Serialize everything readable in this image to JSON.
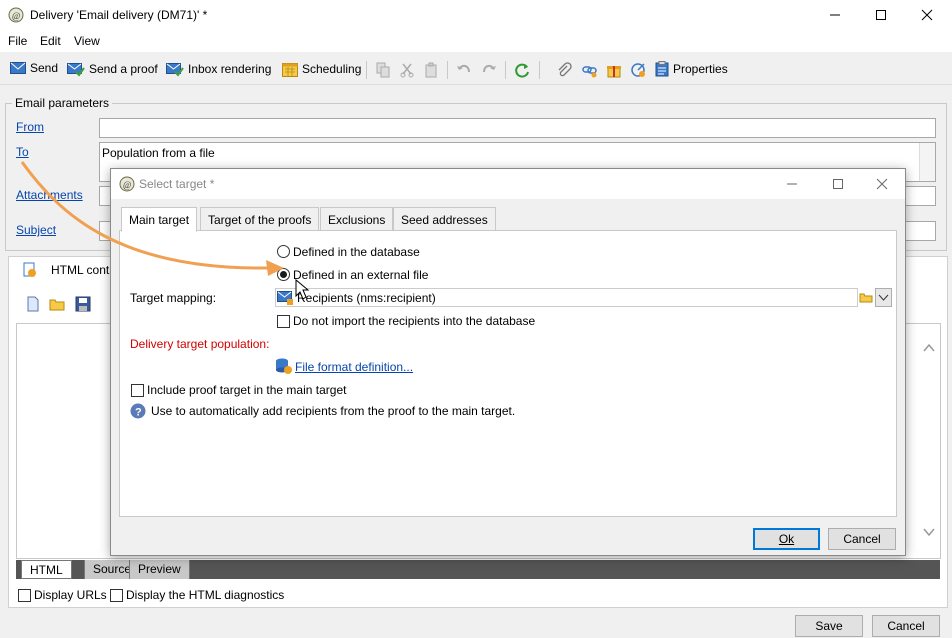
{
  "window": {
    "title": "Delivery 'Email delivery (DM71)' *"
  },
  "menu": [
    "File",
    "Edit",
    "View"
  ],
  "toolbar": {
    "send": "Send",
    "send_proof": "Send a proof",
    "inbox_rendering": "Inbox rendering",
    "scheduling": "Scheduling",
    "properties": "Properties"
  },
  "email_params": {
    "group_title": "Email parameters",
    "from_label": "From",
    "from_value": "",
    "to_label": "To",
    "to_value": "Population from a file",
    "attachments_label": "Attachments",
    "subject_label": "Subject"
  },
  "content": {
    "tab_label": "HTML cont"
  },
  "bottom_tabs": [
    "HTML",
    "Source",
    "Preview"
  ],
  "bottom_options": {
    "display_urls": "Display URLs",
    "display_diag": "Display the HTML diagnostics"
  },
  "footer": {
    "save": "Save",
    "cancel": "Cancel"
  },
  "dialog": {
    "title": "Select target *",
    "tabs": [
      "Main target",
      "Target of the proofs",
      "Exclusions",
      "Seed addresses"
    ],
    "radio_db": "Defined in the database",
    "radio_file": "Defined in an external file",
    "selected_radio": "Defined in an external file",
    "target_mapping_label": "Target mapping:",
    "target_mapping_value": "Recipients (nms:recipient)",
    "no_import": "Do not import the recipients into the database",
    "population_label": "Delivery target population:",
    "file_format_link": "File format definition...",
    "include_proof": "Include proof target in the main target",
    "help_text": "Use to automatically add recipients from the proof to the main target.",
    "ok": "Ok",
    "cancel": "Cancel"
  },
  "colors": {
    "link": "#0645ad",
    "warning_label": "#d40000",
    "annotation_arrow": "#f0a050",
    "ok_border": "#0078d7"
  }
}
